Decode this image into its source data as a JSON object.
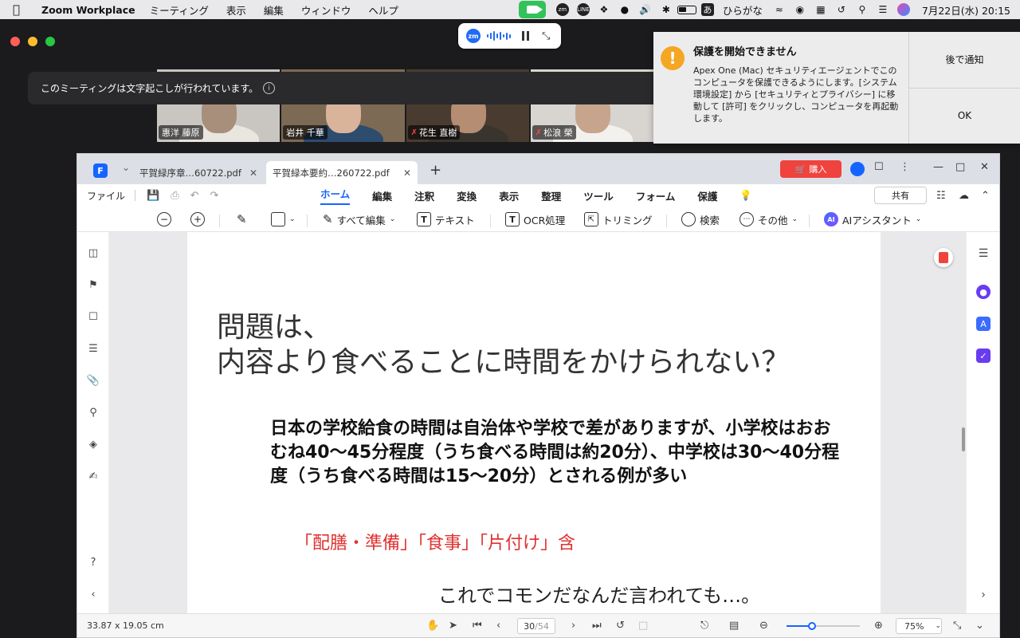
{
  "menubar": {
    "app_name": "Zoom Workplace",
    "menus": [
      "ミーティング",
      "表示",
      "編集",
      "ウィンドウ",
      "ヘルプ"
    ],
    "ime_label": "あ",
    "ime_mode": "ひらがな",
    "datetime": "7月22日(水)  20:15"
  },
  "zoom": {
    "caption_notice": "このミーティングは文字起こしが行われています。",
    "participants": [
      {
        "name": "惠洋 藤原",
        "muted": false
      },
      {
        "name": "岩井 千華",
        "muted": false
      },
      {
        "name": "花生 直樹",
        "muted": true
      },
      {
        "name": "松浪 榮",
        "muted": true
      }
    ],
    "pill_logo": "zm"
  },
  "notification": {
    "title": "保護を開始できません",
    "body": "Apex One (Mac) セキュリティエージェントでこのコンピュータを保護できるようにします。[システム環境設定] から [セキュリティとプライバシー] に移動して [許可] をクリックし、コンピュータを再起動します。",
    "later_label": "後で通知",
    "ok_label": "OK"
  },
  "pdf": {
    "tabs": [
      "平賀緑序章…60722.pdf",
      "平賀緑本要約…260722.pdf"
    ],
    "buy_label": "購入",
    "file_menu": "ファイル",
    "ribbon_tabs": [
      "ホーム",
      "編集",
      "注釈",
      "変換",
      "表示",
      "整理",
      "ツール",
      "フォーム",
      "保護"
    ],
    "share_label": "共有",
    "tools": {
      "edit_all": "すべて編集",
      "text": "テキスト",
      "ocr": "OCR処理",
      "trim": "トリミング",
      "search": "検索",
      "more": "その他",
      "ai": "AIアシスタント"
    },
    "page_content": {
      "heading_line1": "問題は、",
      "heading_line2": "内容より食べることに時間をかけられない？",
      "body": "日本の学校給食の時間は自治体や学校で差がありますが、小学校はおおむね40〜45分程度（うち食べる時間は約20分）、中学校は30〜40分程度（うち食べる時間は15〜20分）とされる例が多い",
      "red_note": "「配膳・準備」「食事」「片付け」含",
      "tail": "これでコモンだなんだ言われても…。"
    },
    "status": {
      "dimensions": "33.87 x 19.05 cm",
      "current_page": "30",
      "total_pages": "/54",
      "zoom": "75%",
      "zoom_level": 0.35
    }
  }
}
